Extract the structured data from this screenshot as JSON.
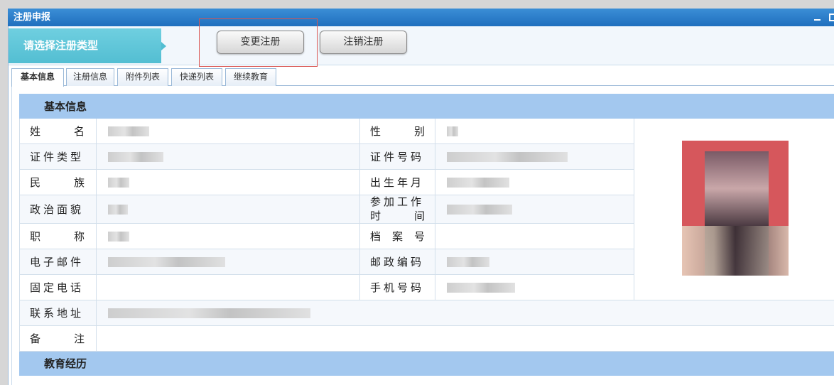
{
  "window": {
    "title": "注册申报"
  },
  "type_bar": {
    "label": "请选择注册类型",
    "buttons": [
      "变更注册",
      "注销注册"
    ]
  },
  "tabs": [
    "基本信息",
    "注册信息",
    "附件列表",
    "快递列表",
    "继续教育"
  ],
  "active_tab": 0,
  "form": {
    "section_basic": "基本信息",
    "section_education": "教育经历",
    "labels": {
      "name": [
        "姓",
        "名"
      ],
      "gender": [
        "性",
        "别"
      ],
      "id_type": "证件类型",
      "id_number": "证件号码",
      "ethnicity": [
        "民",
        "族"
      ],
      "birth": "出生年月",
      "politics": "政治面貌",
      "work_start_1": "参加工作",
      "work_start_2": [
        "时",
        "间"
      ],
      "title": [
        "职",
        "称"
      ],
      "archive": [
        "档",
        "案",
        "号"
      ],
      "email": "电子邮件",
      "postcode": "邮政编码",
      "phone": "固定电话",
      "mobile": "手机号码",
      "address": "联系地址",
      "remark": [
        "备",
        "注"
      ]
    }
  },
  "colors": {
    "title_bar": "#1f6fbe",
    "type_label": "#53bed2",
    "section_header": "#a3c8ef",
    "highlight_box": "#d9534f"
  }
}
